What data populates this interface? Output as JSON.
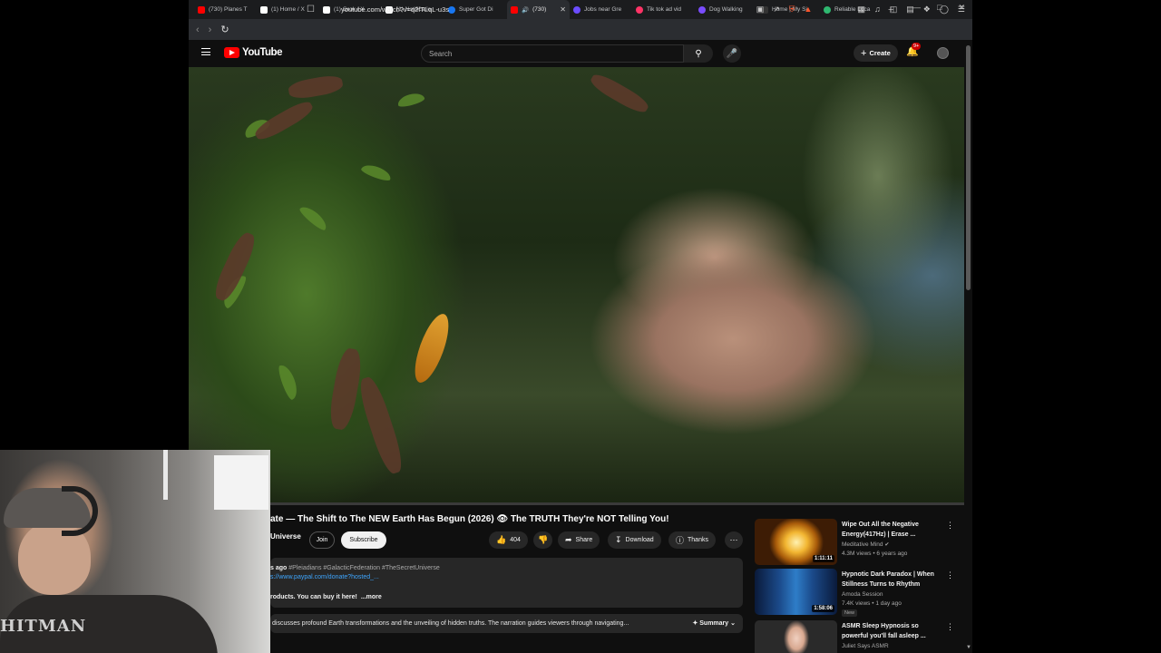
{
  "browser": {
    "tabs": [
      {
        "label": "(730) Planes T",
        "color": "#ff0000"
      },
      {
        "label": "(1) Home / X",
        "color": "#ffffff"
      },
      {
        "label": "(1) Grok / X",
        "color": "#ffffff"
      },
      {
        "label": "(1) Notificatio",
        "color": "#ffffff"
      },
      {
        "label": "Super Got Di",
        "color": "#1877f2"
      },
      {
        "label": "(730)",
        "color": "#ff0000",
        "active": true
      },
      {
        "label": "Jobs near Gre",
        "color": "#6b4cff"
      },
      {
        "label": "Tik tok ad vid",
        "color": "#ff3366"
      },
      {
        "label": "Dog Walking",
        "color": "#7a4cff"
      },
      {
        "label": "Home | My Si",
        "color": "#333333"
      },
      {
        "label": "Reliable Loca",
        "color": "#2fb870"
      }
    ],
    "url": "youtube.com/watch?v=q2fTLqL-u3s"
  },
  "youtube": {
    "logo_text": "YouTube",
    "search_placeholder": "Search",
    "create_label": "Create",
    "notification_badge": "9+"
  },
  "video": {
    "progress_fraction": 0.0,
    "title": "ate — The Shift to The NEW Earth Has Begun (2026) 👁 The TRUTH They're NOT Telling You!",
    "channel": "Universe",
    "join_label": "Join",
    "subscribe_label": "Subscribe",
    "like_count": "404",
    "share_label": "Share",
    "download_label": "Download",
    "thanks_label": "Thanks",
    "description": {
      "posted": "s ago",
      "tags": "#Pleiadians #GalacticFederation #TheSecretUniverse",
      "link": "s://www.paypal.com/donate?hosted_...",
      "line3": "roducts. You can buy it here!",
      "more": "...more"
    },
    "summary_text": "discusses profound Earth transformations and the unveiling of hidden truths. The narration guides viewers through navigating...",
    "summary_label": "Summary"
  },
  "recommendations": [
    {
      "title": "Wipe Out All the Negative Energy(417Hz) | Erase ...",
      "channel": "Meditative Mind",
      "meta": "4.3M views • 6 years ago",
      "duration": "1:11:11",
      "verified": true,
      "new": ""
    },
    {
      "title": "Hypnotic Dark Paradox | When Stillness Turns to Rhythm",
      "channel": "Amoda Session",
      "meta": "7.4K views • 1 day ago",
      "duration": "1:58:06",
      "verified": false,
      "new": "New"
    },
    {
      "title": "ASMR Sleep Hypnosis so powerful you'll fall asleep ...",
      "channel": "Juliet Says ASMR",
      "meta": "",
      "duration": "",
      "verified": false,
      "new": ""
    }
  ],
  "webcam": {
    "shirt_text": "HITMAN"
  }
}
